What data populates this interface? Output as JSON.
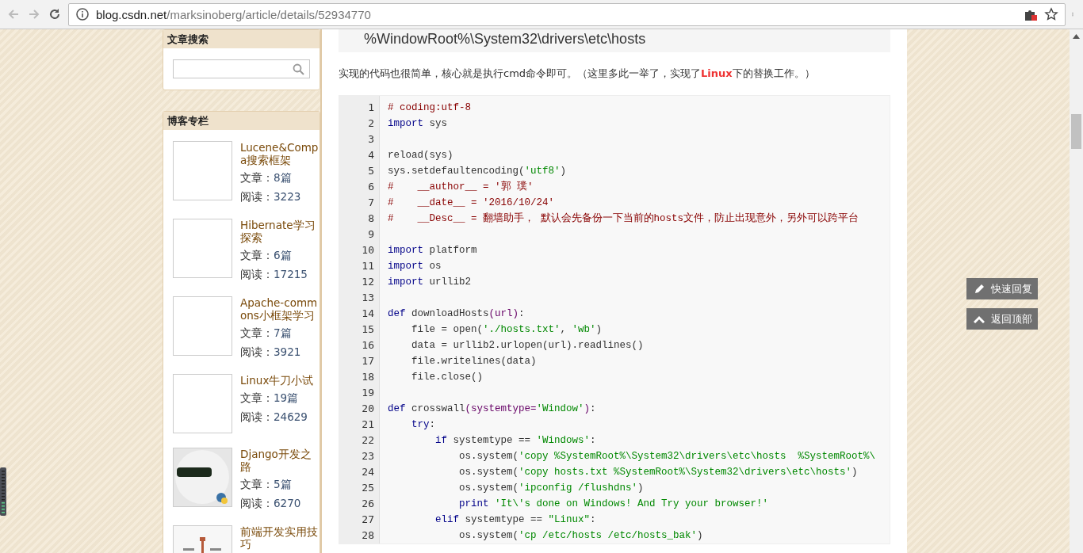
{
  "browser": {
    "url_host": "blog.csdn.net",
    "url_path": "/marksinoberg/article/details/52934770"
  },
  "sidebar": {
    "search": {
      "title": "文章搜索"
    },
    "columns": {
      "title": "博客专栏",
      "items": [
        {
          "title": "Lucene&Compa搜索框架",
          "articles_label": "文章：",
          "articles": "8篇",
          "reads_label": "阅读：",
          "reads": "3223",
          "kind": "blank"
        },
        {
          "title": "Hibernate学习探索",
          "articles_label": "文章：",
          "articles": "6篇",
          "reads_label": "阅读：",
          "reads": "17215",
          "kind": "blank"
        },
        {
          "title": "Apache-commons小框架学习",
          "articles_label": "文章：",
          "articles": "7篇",
          "reads_label": "阅读：",
          "reads": "3921",
          "kind": "blank"
        },
        {
          "title": "Linux牛刀小试",
          "articles_label": "文章：",
          "articles": "19篇",
          "reads_label": "阅读：",
          "reads": "24629",
          "kind": "blank"
        },
        {
          "title": "Django开发之路",
          "articles_label": "文章：",
          "articles": "5篇",
          "reads_label": "阅读：",
          "reads": "6270",
          "kind": "picture"
        },
        {
          "title": "前端开发实用技巧",
          "kind": "picture"
        }
      ]
    }
  },
  "article": {
    "path_block": "%WindowRoot%\\System32\\drivers\\etc\\hosts",
    "paragraph": "实现的代码也很简单，核心就是执行cmd命令即可。（这里多此一举了，实现了**Linux**下的替换工作。）",
    "code": [
      {
        "no": "1",
        "segments": [
          {
            "kind": "comment",
            "text": "# coding:utf-8"
          }
        ]
      },
      {
        "no": "2",
        "segments": [
          {
            "kind": "keyword",
            "text": "import"
          },
          {
            "kind": "plain",
            "text": " sys"
          }
        ]
      },
      {
        "no": "3"
      },
      {
        "no": "4",
        "segments": [
          {
            "kind": "plain",
            "text": "reload(sys)"
          }
        ]
      },
      {
        "no": "5",
        "segments": [
          {
            "kind": "plain",
            "text": "sys.setdefaultencoding("
          },
          {
            "kind": "string",
            "text": "'utf8'"
          },
          {
            "kind": "plain",
            "text": ")"
          }
        ]
      },
      {
        "no": "6",
        "segments": [
          {
            "kind": "comment",
            "text": "#    __author__ = '郭 璞'"
          }
        ]
      },
      {
        "no": "7",
        "segments": [
          {
            "kind": "comment",
            "text": "#    __date__ = '2016/10/24'"
          }
        ]
      },
      {
        "no": "8",
        "segments": [
          {
            "kind": "comment",
            "text": "#    __Desc__ = 翻墙助手， 默认会先备份一下当前的hosts文件，防止出现意外，另外可以跨平台"
          }
        ]
      },
      {
        "no": "9"
      },
      {
        "no": "10",
        "segments": [
          {
            "kind": "keyword",
            "text": "import"
          },
          {
            "kind": "plain",
            "text": " platform"
          }
        ]
      },
      {
        "no": "11",
        "segments": [
          {
            "kind": "keyword",
            "text": "import"
          },
          {
            "kind": "plain",
            "text": " os"
          }
        ]
      },
      {
        "no": "12",
        "segments": [
          {
            "kind": "keyword",
            "text": "import"
          },
          {
            "kind": "plain",
            "text": " urllib2"
          }
        ]
      },
      {
        "no": "13"
      },
      {
        "no": "14",
        "segments": [
          {
            "kind": "keyword",
            "text": "def"
          },
          {
            "kind": "plain",
            "text": " downloadHosts"
          },
          {
            "kind": "param",
            "text": "(url)"
          },
          {
            "kind": "plain",
            "text": ":"
          }
        ]
      },
      {
        "no": "15",
        "segments": [
          {
            "kind": "plain",
            "text": "    file = open("
          },
          {
            "kind": "string",
            "text": "'./hosts.txt'"
          },
          {
            "kind": "plain",
            "text": ", "
          },
          {
            "kind": "string",
            "text": "'wb'"
          },
          {
            "kind": "plain",
            "text": ")"
          }
        ]
      },
      {
        "no": "16",
        "segments": [
          {
            "kind": "plain",
            "text": "    data = urllib2.urlopen(url).readlines()"
          }
        ]
      },
      {
        "no": "17",
        "segments": [
          {
            "kind": "plain",
            "text": "    file.writelines(data)"
          }
        ]
      },
      {
        "no": "18",
        "segments": [
          {
            "kind": "plain",
            "text": "    file.close()"
          }
        ]
      },
      {
        "no": "19"
      },
      {
        "no": "20",
        "segments": [
          {
            "kind": "keyword",
            "text": "def"
          },
          {
            "kind": "plain",
            "text": " crosswall"
          },
          {
            "kind": "param",
            "text": "(systemtype="
          },
          {
            "kind": "string",
            "text": "'Window'"
          },
          {
            "kind": "param",
            "text": ")"
          },
          {
            "kind": "plain",
            "text": ":"
          }
        ]
      },
      {
        "no": "21",
        "segments": [
          {
            "kind": "keyword",
            "text": "    try"
          },
          {
            "kind": "plain",
            "text": ":"
          }
        ]
      },
      {
        "no": "22",
        "segments": [
          {
            "kind": "keyword",
            "text": "        if"
          },
          {
            "kind": "plain",
            "text": " systemtype == "
          },
          {
            "kind": "string",
            "text": "'Windows'"
          },
          {
            "kind": "plain",
            "text": ":"
          }
        ]
      },
      {
        "no": "23",
        "segments": [
          {
            "kind": "plain",
            "text": "            os.system("
          },
          {
            "kind": "string",
            "text": "'copy %SystemRoot%\\System32\\drivers\\etc\\hosts  %SystemRoot%\\"
          }
        ]
      },
      {
        "no": "24",
        "segments": [
          {
            "kind": "plain",
            "text": "            os.system("
          },
          {
            "kind": "string",
            "text": "'copy hosts.txt %SystemRoot%\\System32\\drivers\\etc\\hosts'"
          },
          {
            "kind": "plain",
            "text": ")"
          }
        ]
      },
      {
        "no": "25",
        "segments": [
          {
            "kind": "plain",
            "text": "            os.system("
          },
          {
            "kind": "string",
            "text": "'ipconfig /flushdns'"
          },
          {
            "kind": "plain",
            "text": ")"
          }
        ]
      },
      {
        "no": "26",
        "segments": [
          {
            "kind": "keyword",
            "text": "            print"
          },
          {
            "kind": "string",
            "text": " 'It\\'s done on Windows! And Try your browser!'"
          }
        ]
      },
      {
        "no": "27",
        "segments": [
          {
            "kind": "keyword",
            "text": "        elif"
          },
          {
            "kind": "plain",
            "text": " systemtype == "
          },
          {
            "kind": "string",
            "text": "\"Linux\""
          },
          {
            "kind": "plain",
            "text": ":"
          }
        ]
      },
      {
        "no": "28",
        "segments": [
          {
            "kind": "plain",
            "text": "            os.system("
          },
          {
            "kind": "string",
            "text": "'cp /etc/hosts /etc/hosts_bak'"
          },
          {
            "kind": "plain",
            "text": ")"
          }
        ]
      }
    ]
  },
  "float_buttons": [
    {
      "kind": "reply",
      "label": "快速回复"
    },
    {
      "kind": "top",
      "label": "返回顶部"
    }
  ]
}
